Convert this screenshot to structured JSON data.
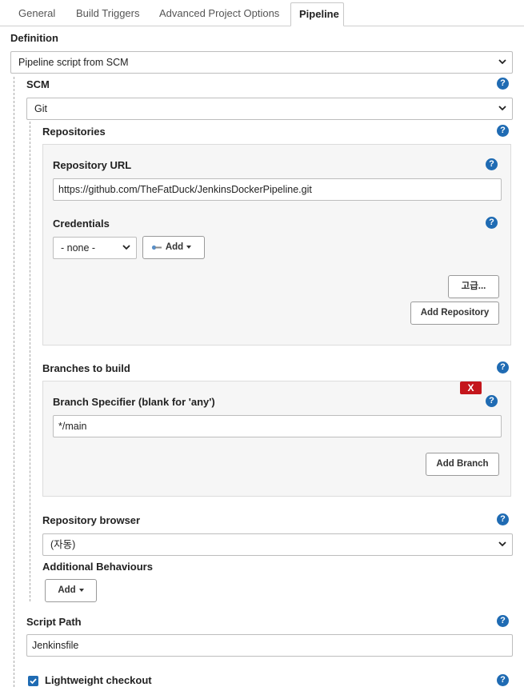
{
  "tabs": {
    "general": "General",
    "build_triggers": "Build Triggers",
    "advanced": "Advanced Project Options",
    "pipeline": "Pipeline"
  },
  "definition": {
    "label": "Definition",
    "value": "Pipeline script from SCM"
  },
  "scm": {
    "label": "SCM",
    "value": "Git"
  },
  "repositories": {
    "label": "Repositories",
    "url_label": "Repository URL",
    "url_value": "https://github.com/TheFatDuck/JenkinsDockerPipeline.git",
    "credentials_label": "Credentials",
    "credentials_value": "- none -",
    "add_label": "Add",
    "advanced_label": "고급...",
    "add_repository_label": "Add Repository"
  },
  "branches": {
    "label": "Branches to build",
    "remove_label": "X",
    "specifier_label": "Branch Specifier (blank for 'any')",
    "specifier_value": "*/main",
    "add_branch_label": "Add Branch"
  },
  "repo_browser": {
    "label": "Repository browser",
    "value": "(자동)"
  },
  "additional": {
    "label": "Additional Behaviours",
    "add_label": "Add"
  },
  "script_path": {
    "label": "Script Path",
    "value": "Jenkinsfile"
  },
  "lightweight": {
    "label": "Lightweight checkout",
    "checked": true
  },
  "help_glyph": "?",
  "icons": {
    "help": "question-circle-icon",
    "dropdown": "chevron-down-icon",
    "key": "key-icon",
    "check": "check-icon"
  },
  "colors": {
    "help_blue": "#1f6bb3",
    "danger_red": "#c4161c",
    "panel_bg": "#f6f6f6"
  }
}
